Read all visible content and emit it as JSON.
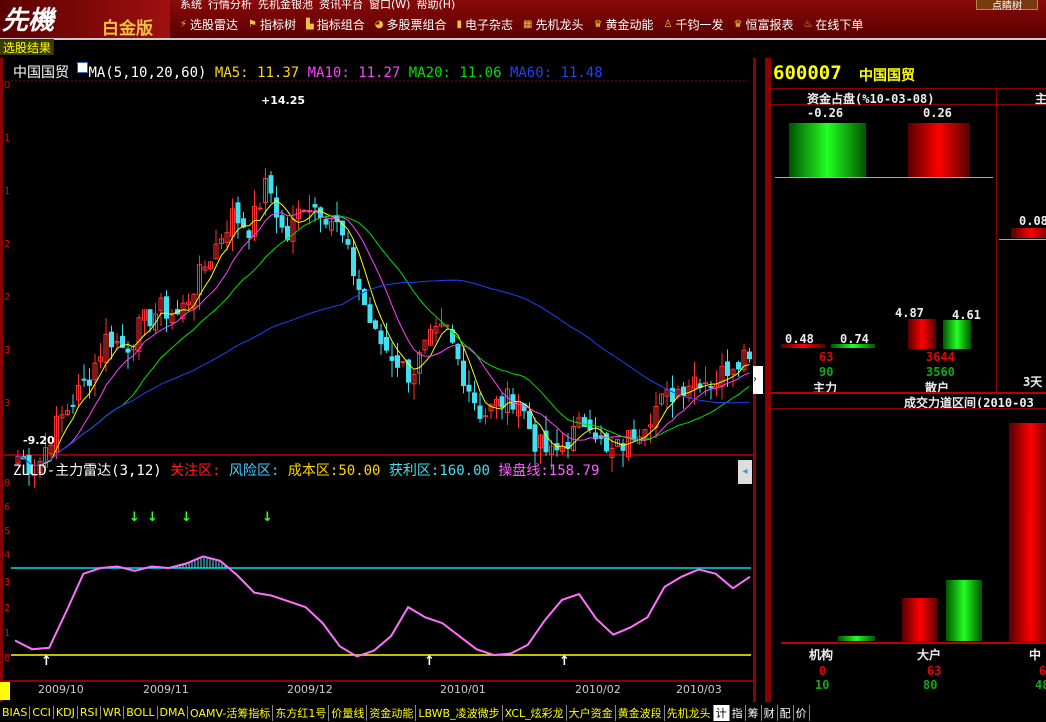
{
  "app": {
    "logo": "先機",
    "edition": "白金版",
    "login_button": "点睛树"
  },
  "menu": [
    "系统",
    "行情分析",
    "先机金银池",
    "资讯平台",
    "窗口(W)",
    "帮助(H)"
  ],
  "toolbar": [
    {
      "label": "选股雷达",
      "icon": "lightning-icon"
    },
    {
      "label": "指标树",
      "icon": "flag-icon"
    },
    {
      "label": "指标组合",
      "icon": "combo-icon"
    },
    {
      "label": "多股票组合",
      "icon": "pie-icon"
    },
    {
      "label": "电子杂志",
      "icon": "magazine-icon"
    },
    {
      "label": "先机龙头",
      "icon": "calendar-icon"
    },
    {
      "label": "黄金动能",
      "icon": "crown-icon"
    },
    {
      "label": "千钧一发",
      "icon": "bell-icon"
    },
    {
      "label": "恒富报表",
      "icon": "crown-icon"
    },
    {
      "label": "在线下单",
      "icon": "fire-icon"
    }
  ],
  "tab": "选股结果",
  "price_chart": {
    "stock_name": "中国国贸",
    "indicator": "MA(5,10,20,60)",
    "ma5": "MA5: 11.37",
    "ma10": "MA10: 11.27",
    "ma20": "MA20: 11.06",
    "ma60": "MA60: 11.48",
    "high_label": "14.25",
    "low_label": "9.20",
    "y_ticks": [
      "0",
      "1",
      "1",
      "2",
      "2",
      "3",
      "3"
    ],
    "colors": {
      "up": "#ff3030",
      "down": "#40e0f0",
      "ma5": "#ffff00",
      "ma10": "#ff40ff",
      "ma20": "#00e000",
      "ma60": "#2040ff"
    },
    "key_closes": [
      9.8,
      9.6,
      10.2,
      10.6,
      11.0,
      11.6,
      11.4,
      11.8,
      12.0,
      11.9,
      12.4,
      12.9,
      13.4,
      13.2,
      13.9,
      13.0,
      13.6,
      13.5,
      13.2,
      12.4,
      11.6,
      11.3,
      11.0,
      11.5,
      11.7,
      11.0,
      10.4,
      10.6,
      10.7,
      10.0,
      9.8,
      10.1,
      10.4,
      9.8,
      10.0,
      10.3,
      10.6,
      10.8,
      11.0,
      10.9,
      11.2,
      11.4
    ]
  },
  "indicator_chart": {
    "title": "ZLLD-主力雷达(3,12)",
    "focus": "关注区:",
    "risk": "风险区:",
    "cost": "成本区:50.00",
    "profit": "获利区:160.00",
    "line": "操盘线:158.79",
    "y_ticks": [
      "8",
      "6",
      "5",
      "4",
      "3",
      "2",
      "1",
      "8"
    ],
    "line_values": [
      1.0,
      0.4,
      0.5,
      3,
      5.6,
      6,
      6.1,
      5.8,
      6.1,
      6.0,
      6.3,
      6.8,
      6.5,
      5.5,
      4.3,
      4.1,
      3.7,
      3.3,
      2.2,
      0.6,
      -0.1,
      0.3,
      1.3,
      3.3,
      2.6,
      2.2,
      1.3,
      0.4,
      0,
      0.1,
      0.7,
      2.4,
      3.8,
      4.2,
      2.5,
      1.4,
      1.9,
      2.6,
      4.7,
      5.4,
      5.9,
      5.6,
      4.6,
      5.4
    ]
  },
  "dates": [
    "2009/10",
    "2009/11",
    "2009/12",
    "2010/01",
    "2010/02",
    "2010/03"
  ],
  "right": {
    "code": "600007",
    "name": "中国国贸",
    "fund_title": "资金占盘(%10-03-08)",
    "main_title": "主",
    "top_neg": "-0.26",
    "top_pos": "0.26",
    "side_val": "0.08",
    "main_red": "0.48",
    "main_green": "0.74",
    "retail_red": "4.87",
    "retail_green": "4.61",
    "main_n1": "63",
    "main_n2": "90",
    "retail_n1": "3644",
    "retail_n2": "3560",
    "main_label": "主力",
    "retail_label": "散户",
    "days": "3天",
    "volume_title": "成交力道区间(2010-03",
    "groups": [
      {
        "label": "机构",
        "n1": "0",
        "n2": "10"
      },
      {
        "label": "大户",
        "n1": "63",
        "n2": "80"
      },
      {
        "label": "中",
        "n1": "61",
        "n2": "48"
      }
    ]
  },
  "bottom_tabs": [
    "BIAS",
    "CCI",
    "KDJ",
    "RSI",
    "WR",
    "BOLL",
    "DMA",
    "OAMV-活筹指标",
    "东方红1号",
    "价量线",
    "资金动能",
    "LBWB_凌波微步",
    "XCL_炫彩龙",
    "大户资金",
    "黄金波段",
    "先机龙头",
    "计",
    "指",
    "筹",
    "财",
    "配",
    "价"
  ]
}
